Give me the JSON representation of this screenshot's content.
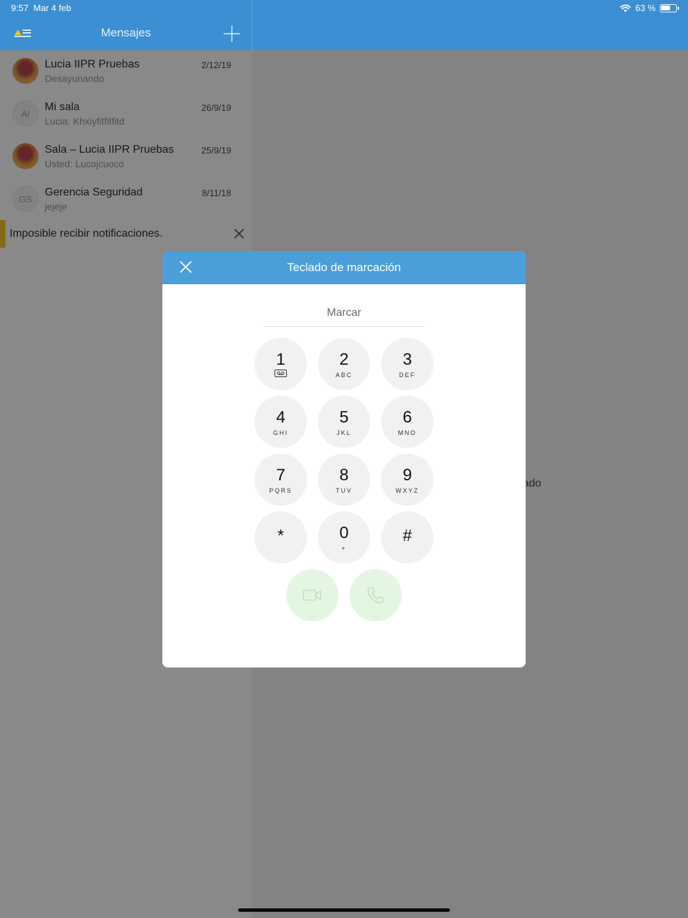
{
  "status_bar": {
    "time": "9:57",
    "date": "Mar 4 feb",
    "battery": "63 %",
    "battery_level": 0.63
  },
  "nav": {
    "title": "Mensajes"
  },
  "conversations": [
    {
      "avatar": "",
      "avatar_type": "image",
      "name": "Lucia IIPR Pruebas",
      "last_message": "Desayunando",
      "date": "2/12/19"
    },
    {
      "avatar": "AI",
      "avatar_type": "initials",
      "name": "Mi sala",
      "last_message": "Lucia: Khxiyfitfitfitd",
      "date": "26/9/19"
    },
    {
      "avatar": "",
      "avatar_type": "image",
      "name": "Sala – Lucia IIPR Pruebas",
      "last_message": "Usted: Lucojcuoco",
      "date": "25/9/19"
    },
    {
      "avatar": "GS",
      "avatar_type": "initials",
      "name": "Gerencia Seguridad",
      "last_message": "jejeje",
      "date": "8/11/18"
    }
  ],
  "notice": {
    "text": "Imposible recibir notificaciones."
  },
  "right_pane": {
    "partial_text": "ado"
  },
  "dialpad": {
    "title": "Teclado de marcación",
    "input_placeholder": "Marcar",
    "keys": [
      {
        "digit": "1",
        "letters": "",
        "icon": "voicemail-icon"
      },
      {
        "digit": "2",
        "letters": "ABC"
      },
      {
        "digit": "3",
        "letters": "DEF"
      },
      {
        "digit": "4",
        "letters": "GHI"
      },
      {
        "digit": "5",
        "letters": "JKL"
      },
      {
        "digit": "6",
        "letters": "MNO"
      },
      {
        "digit": "7",
        "letters": "PQRS"
      },
      {
        "digit": "8",
        "letters": "TUV"
      },
      {
        "digit": "9",
        "letters": "WXYZ"
      },
      {
        "digit": "*",
        "letters": ""
      },
      {
        "digit": "0",
        "letters": "+"
      },
      {
        "digit": "#",
        "letters": ""
      }
    ],
    "actions": [
      {
        "icon": "video-call-icon"
      },
      {
        "icon": "phone-call-icon"
      }
    ]
  },
  "colors": {
    "accent": "#3b8fd2",
    "modal_header": "#4a9fd9",
    "notice_bar": "#f5c518",
    "call_button": "#e3f6e2"
  }
}
